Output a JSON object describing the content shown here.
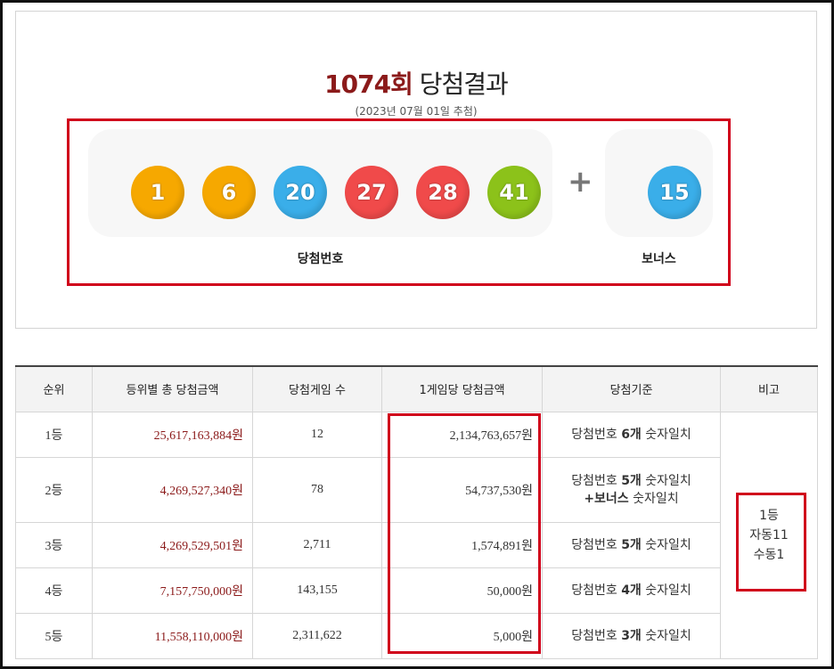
{
  "header": {
    "round": "1074회",
    "title_suffix": "당첨결과",
    "draw_date": "(2023년 07월 01일 추첨)"
  },
  "balls": [
    {
      "number": "1",
      "color": "#f6a800"
    },
    {
      "number": "6",
      "color": "#f6a800"
    },
    {
      "number": "20",
      "color": "#3aaee9"
    },
    {
      "number": "27",
      "color": "#f04a4a"
    },
    {
      "number": "28",
      "color": "#f04a4a"
    },
    {
      "number": "41",
      "color": "#8cc21a"
    }
  ],
  "plus_sign": "+",
  "bonus": {
    "number": "15",
    "color": "#3aaee9"
  },
  "captions": {
    "main": "당첨번호",
    "bonus": "보너스"
  },
  "table": {
    "headers": [
      "순위",
      "등위별 총 당첨금액",
      "당첨게임 수",
      "1게임당 당첨금액",
      "당첨기준",
      "비고"
    ],
    "rows": [
      {
        "rank": "1등",
        "total": "25,617,163,884원",
        "games": "12",
        "per_game": "2,134,763,657원",
        "crit_pre": "당첨번호 ",
        "crit_bold": "6개",
        "crit_post": " 숫자일치",
        "crit_line2_bold": "",
        "crit_line2_post": ""
      },
      {
        "rank": "2등",
        "total": "4,269,527,340원",
        "games": "78",
        "per_game": "54,737,530원",
        "crit_pre": "당첨번호 ",
        "crit_bold": "5개",
        "crit_post": " 숫자일치",
        "crit_line2_bold": "+보너스",
        "crit_line2_post": " 숫자일치"
      },
      {
        "rank": "3등",
        "total": "4,269,529,501원",
        "games": "2,711",
        "per_game": "1,574,891원",
        "crit_pre": "당첨번호 ",
        "crit_bold": "5개",
        "crit_post": " 숫자일치",
        "crit_line2_bold": "",
        "crit_line2_post": ""
      },
      {
        "rank": "4등",
        "total": "7,157,750,000원",
        "games": "143,155",
        "per_game": "50,000원",
        "crit_pre": "당첨번호 ",
        "crit_bold": "4개",
        "crit_post": " 숫자일치",
        "crit_line2_bold": "",
        "crit_line2_post": ""
      },
      {
        "rank": "5등",
        "total": "11,558,110,000원",
        "games": "2,311,622",
        "per_game": "5,000원",
        "crit_pre": "당첨번호 ",
        "crit_bold": "3개",
        "crit_post": " 숫자일치",
        "crit_line2_bold": "",
        "crit_line2_post": ""
      }
    ],
    "note": {
      "line1": "1등",
      "line2": "자동11",
      "line3": "수동1"
    }
  },
  "colors": {
    "accent": "#8b1a1a",
    "highlight": "#d0021b"
  }
}
